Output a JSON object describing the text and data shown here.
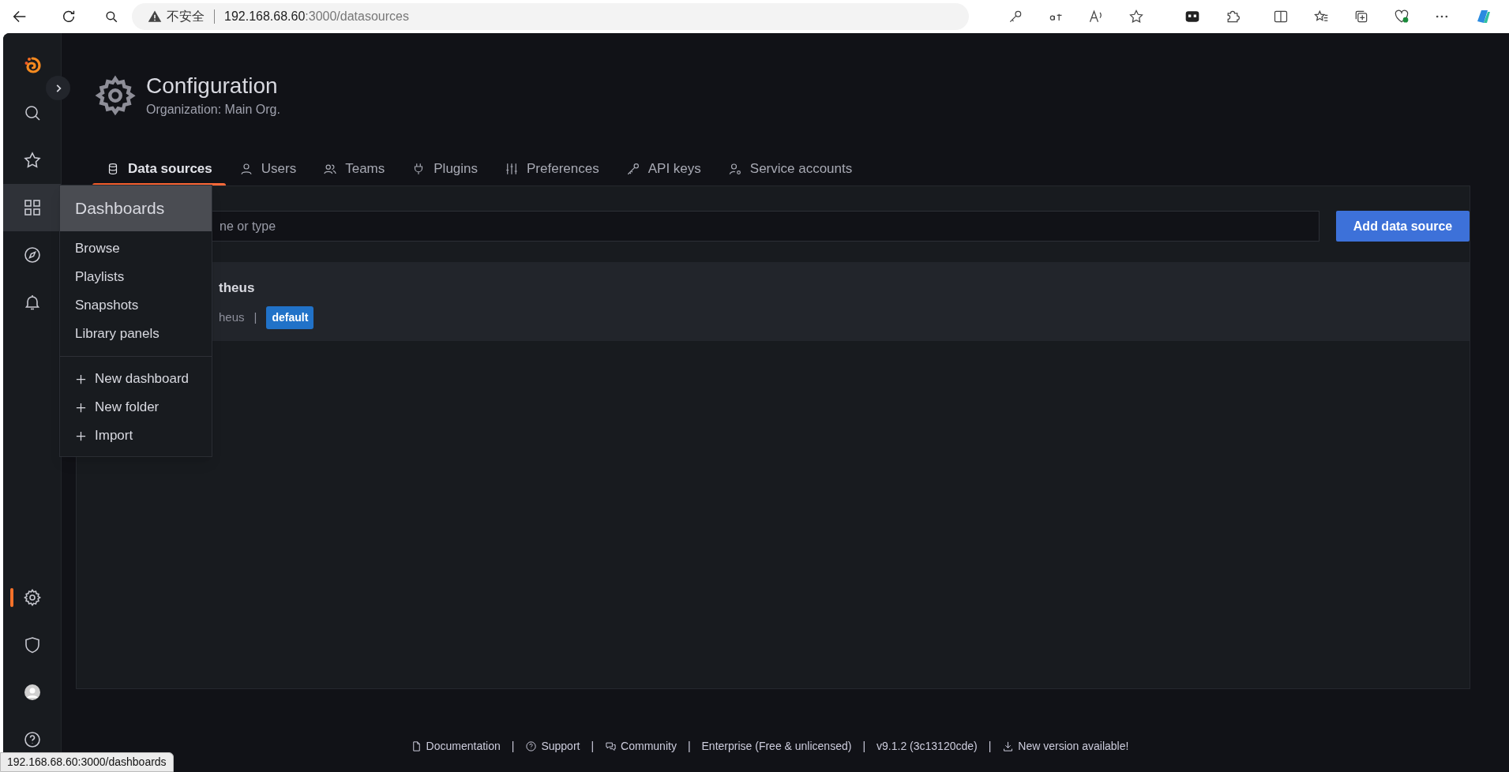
{
  "browser": {
    "security_label": "不安全",
    "url_host": "192.168.68.60",
    "url_path": ":3000/datasources"
  },
  "sidebar": {
    "top_items": [
      {
        "kind": "logo",
        "selected": false,
        "current": false
      },
      {
        "kind": "search",
        "selected": false,
        "current": false
      },
      {
        "kind": "starred",
        "selected": false,
        "current": false
      },
      {
        "kind": "dashboards",
        "selected": true,
        "current": false
      },
      {
        "kind": "explore",
        "selected": false,
        "current": false
      },
      {
        "kind": "alerting",
        "selected": false,
        "current": false
      }
    ],
    "bottom_items": [
      {
        "kind": "configuration",
        "selected": false,
        "current": true
      },
      {
        "kind": "admin",
        "selected": false,
        "current": false
      },
      {
        "kind": "profile",
        "selected": false,
        "current": false
      },
      {
        "kind": "help",
        "selected": false,
        "current": false
      }
    ]
  },
  "page_header": {
    "title": "Configuration",
    "subtitle": "Organization: Main Org."
  },
  "tabs": [
    {
      "kind": "database",
      "label": "Data sources",
      "selected": true
    },
    {
      "kind": "user",
      "label": "Users",
      "selected": false
    },
    {
      "kind": "users",
      "label": "Teams",
      "selected": false
    },
    {
      "kind": "plug",
      "label": "Plugins",
      "selected": false
    },
    {
      "kind": "sliders",
      "label": "Preferences",
      "selected": false
    },
    {
      "kind": "key",
      "label": "API keys",
      "selected": false
    },
    {
      "kind": "user-cog",
      "label": "Service accounts",
      "selected": false
    }
  ],
  "search": {
    "placeholder": "ne or type"
  },
  "add_button": "Add data source",
  "datasources": [
    {
      "name": "theus",
      "type": "heus",
      "separator": "|",
      "badge": "default"
    }
  ],
  "dashboards_menu": {
    "title": "Dashboards",
    "items": [
      "Browse",
      "Playlists",
      "Snapshots",
      "Library panels"
    ],
    "actions": [
      "New dashboard",
      "New folder",
      "Import"
    ]
  },
  "footer": [
    {
      "kind": "doc",
      "label": "Documentation"
    },
    {
      "kind": "question",
      "label": "Support",
      "separator": "|"
    },
    {
      "kind": "comment",
      "label": "Community",
      "separator": "|"
    },
    {
      "kind": "none",
      "label": "Enterprise (Free & unlicensed)",
      "separator": "|"
    },
    {
      "kind": "none",
      "label": "v9.1.2 (3c13120cde)",
      "separator": "|"
    },
    {
      "kind": "download",
      "label": "New version available!",
      "separator": "|"
    }
  ],
  "status_url": "192.168.68.60:3000/dashboards"
}
